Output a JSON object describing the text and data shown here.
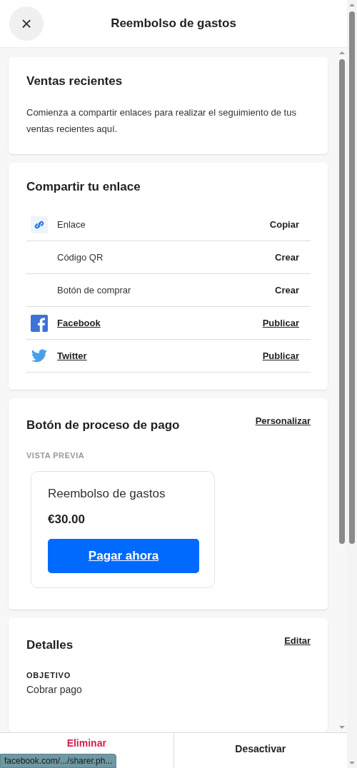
{
  "header": {
    "title": "Reembolso de gastos",
    "close": "×"
  },
  "recent_sales": {
    "title": "Ventas recientes",
    "text": "Comienza a compartir enlaces para realizar el seguimiento de tus ventas recientes aquí."
  },
  "share": {
    "title": "Compartir tu enlace",
    "rows": [
      {
        "kind": "link",
        "label": "Enlace",
        "action": "Copiar"
      },
      {
        "kind": "plain",
        "label": "Código QR",
        "action": "Crear"
      },
      {
        "kind": "plain",
        "label": "Botón de comprar",
        "action": "Crear"
      },
      {
        "kind": "facebook",
        "label": "Facebook",
        "action": "Publicar"
      },
      {
        "kind": "twitter",
        "label": "Twitter",
        "action": "Publicar"
      }
    ]
  },
  "checkout": {
    "title": "Botón de proceso de pago",
    "action": "Personalizar",
    "preview_label": "VISTA PREVIA",
    "preview": {
      "title": "Reembolso de gastos",
      "price": "€30.00",
      "button": "Pagar ahora"
    }
  },
  "details": {
    "title": "Detalles",
    "action": "Editar",
    "field_label": "OBJETIVO",
    "field_value": "Cobrar pago"
  },
  "footer": {
    "buttons": [
      {
        "kind": "danger",
        "label": "Eliminar"
      },
      {
        "kind": "normal",
        "label": "Desactivar"
      }
    ]
  },
  "status_bar": {
    "url": "facebook.com/.../sharer.ph..."
  }
}
